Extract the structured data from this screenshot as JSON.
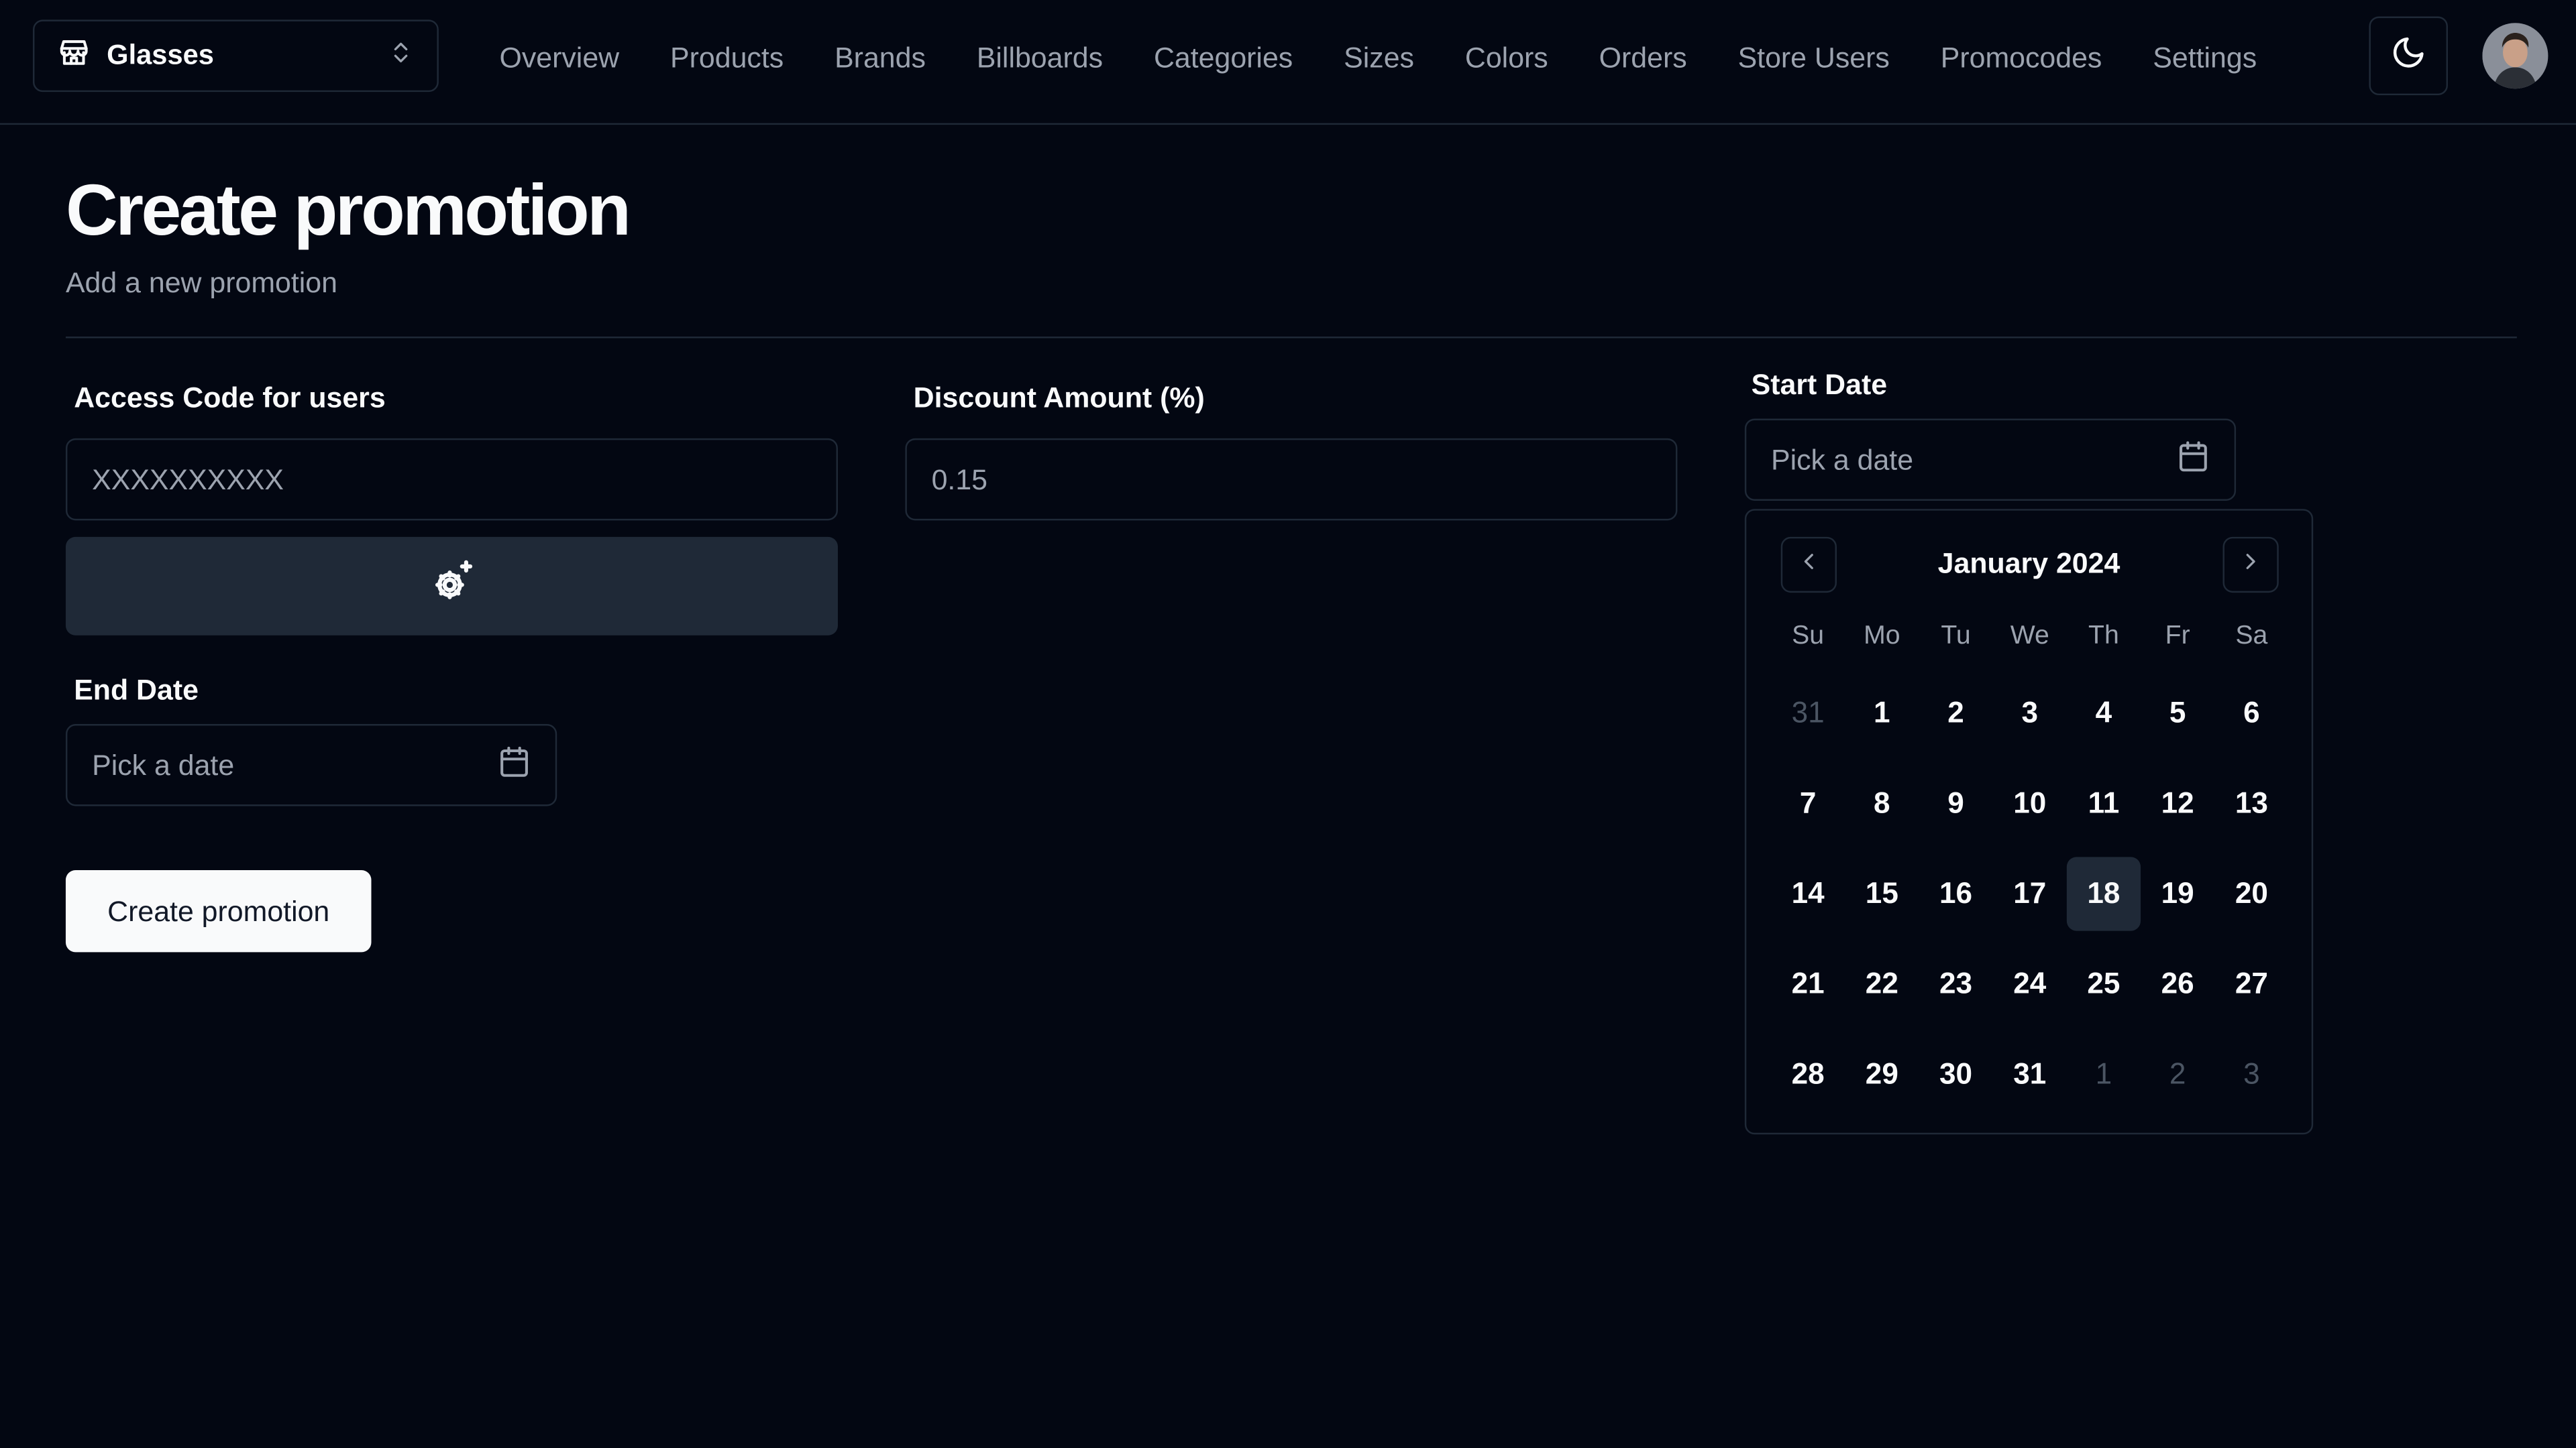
{
  "header": {
    "store_name": "Glasses",
    "nav": [
      "Overview",
      "Products",
      "Brands",
      "Billboards",
      "Categories",
      "Sizes",
      "Colors",
      "Orders",
      "Store Users",
      "Promocodes",
      "Settings"
    ]
  },
  "page": {
    "title": "Create promotion",
    "subtitle": "Add a new promotion"
  },
  "form": {
    "access_code": {
      "label": "Access Code for users",
      "placeholder": "XXXXXXXXXX"
    },
    "discount": {
      "label": "Discount Amount (%)",
      "placeholder": "0.15"
    },
    "start_date": {
      "label": "Start Date",
      "placeholder": "Pick a date"
    },
    "end_date": {
      "label": "End Date",
      "placeholder": "Pick a date"
    },
    "submit_label": "Create promotion"
  },
  "calendar": {
    "month": "January 2024",
    "weekdays": [
      "Su",
      "Mo",
      "Tu",
      "We",
      "Th",
      "Fr",
      "Sa"
    ],
    "weeks": [
      [
        {
          "d": "31",
          "o": true
        },
        {
          "d": "1"
        },
        {
          "d": "2"
        },
        {
          "d": "3"
        },
        {
          "d": "4"
        },
        {
          "d": "5"
        },
        {
          "d": "6"
        }
      ],
      [
        {
          "d": "7"
        },
        {
          "d": "8"
        },
        {
          "d": "9"
        },
        {
          "d": "10"
        },
        {
          "d": "11"
        },
        {
          "d": "12"
        },
        {
          "d": "13"
        }
      ],
      [
        {
          "d": "14"
        },
        {
          "d": "15"
        },
        {
          "d": "16"
        },
        {
          "d": "17"
        },
        {
          "d": "18",
          "t": true
        },
        {
          "d": "19"
        },
        {
          "d": "20"
        }
      ],
      [
        {
          "d": "21"
        },
        {
          "d": "22"
        },
        {
          "d": "23"
        },
        {
          "d": "24"
        },
        {
          "d": "25"
        },
        {
          "d": "26"
        },
        {
          "d": "27"
        }
      ],
      [
        {
          "d": "28"
        },
        {
          "d": "29"
        },
        {
          "d": "30"
        },
        {
          "d": "31"
        },
        {
          "d": "1",
          "o": true
        },
        {
          "d": "2",
          "o": true
        },
        {
          "d": "3",
          "o": true
        }
      ]
    ]
  },
  "colors": {
    "background": "#030712",
    "border": "#1f2937",
    "muted": "#9ca3af",
    "primary": "#f9fafb"
  },
  "icons": {
    "store": "store-icon",
    "switcher": "chevrons-up-down-icon",
    "theme": "moon-icon",
    "generate": "cog-sparkle-icon",
    "calendar": "calendar-icon"
  }
}
